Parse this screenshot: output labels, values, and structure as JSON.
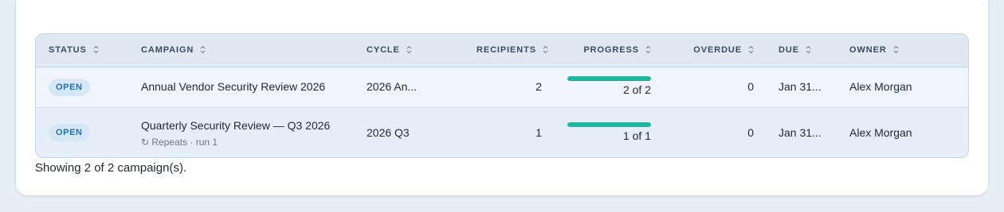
{
  "table": {
    "columns": {
      "status": "STATUS",
      "campaign": "CAMPAIGN",
      "cycle": "CYCLE",
      "recipients": "RECIPIENTS",
      "progress": "PROGRESS",
      "overdue": "OVERDUE",
      "due": "DUE",
      "owner": "OWNER"
    },
    "rows": [
      {
        "status": "OPEN",
        "campaign": "Annual Vendor Security Review 2026",
        "subtitle": "",
        "cycle": "2026 An...",
        "recipients": "2",
        "progress_label": "2 of 2",
        "progress_fraction": 1.0,
        "overdue": "0",
        "due": "Jan 31...",
        "owner": "Alex Morgan"
      },
      {
        "status": "OPEN",
        "campaign": "Quarterly Security Review — Q3 2026",
        "subtitle": "↻ Repeats · run 1",
        "cycle": "2026 Q3",
        "recipients": "1",
        "progress_label": "1 of 1",
        "progress_fraction": 1.0,
        "overdue": "0",
        "due": "Jan 31...",
        "owner": "Alex Morgan"
      }
    ]
  },
  "footer": {
    "summary": "Showing 2 of 2 campaign(s)."
  },
  "icons": {
    "sort": "sort-icon",
    "repeat": "repeat-icon"
  },
  "colors": {
    "badge_bg": "#d6e8f8",
    "badge_text": "#1f6fb2",
    "progress": "#1fb5a0"
  }
}
